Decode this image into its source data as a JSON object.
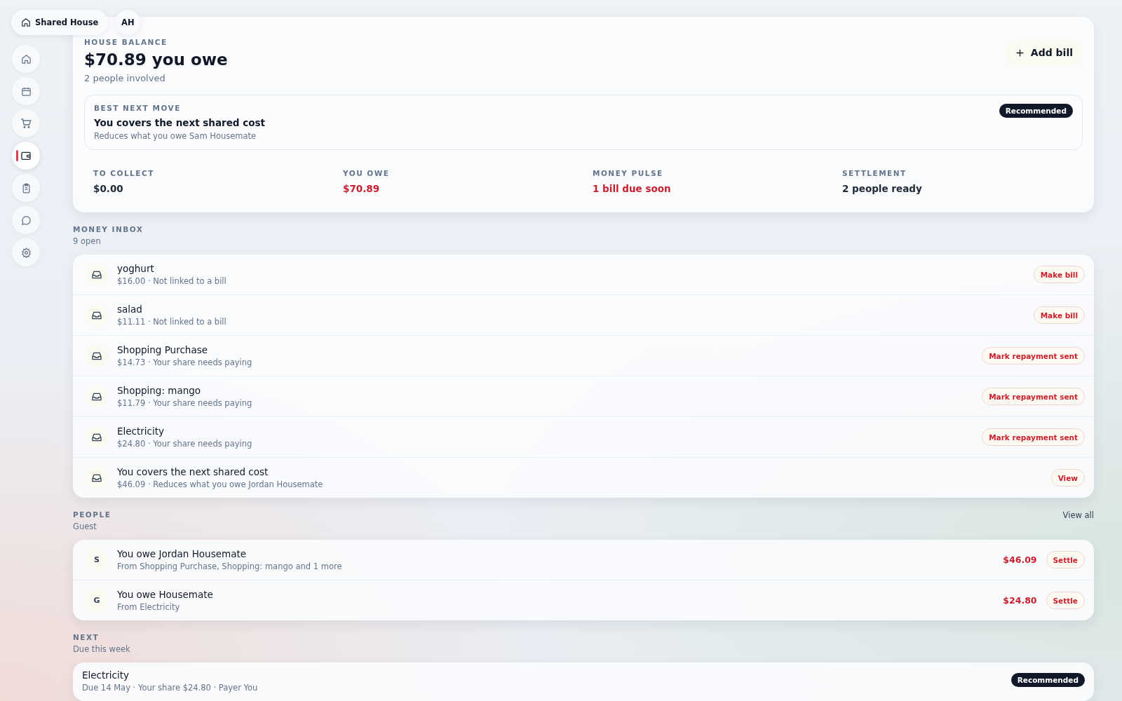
{
  "header": {
    "house": "Shared House",
    "avatar": "AH"
  },
  "sidebar": {
    "items": [
      {
        "selected": false
      },
      {
        "selected": false
      },
      {
        "selected": false
      },
      {
        "selected": true
      },
      {
        "selected": false
      },
      {
        "selected": false
      },
      {
        "selected": false
      }
    ]
  },
  "balance": {
    "eyebrow": "HOUSE BALANCE",
    "title": "$70.89 you owe",
    "subtitle": "2 people involved",
    "add_button": "Add bill",
    "best_move": {
      "eyebrow": "BEST NEXT MOVE",
      "title": "You covers the next shared cost",
      "detail": "Reduces what you owe Sam Housemate",
      "badge": "Recommended"
    },
    "stats": [
      {
        "label": "TO COLLECT",
        "value": "$0.00",
        "alert": false
      },
      {
        "label": "YOU OWE",
        "value": "$70.89",
        "alert": true
      },
      {
        "label": "MONEY PULSE",
        "value": "1 bill due soon",
        "alert": true
      },
      {
        "label": "SETTLEMENT",
        "value": "2 people ready",
        "alert": false
      }
    ]
  },
  "inbox": {
    "title": "MONEY INBOX",
    "subtitle": "9 open",
    "rows": [
      {
        "title": "yoghurt",
        "detail": "$16.00 · Not linked to a bill",
        "action": "Make bill"
      },
      {
        "title": "salad",
        "detail": "$11.11 · Not linked to a bill",
        "action": "Make bill"
      },
      {
        "title": "Shopping Purchase",
        "detail": "$14.73 · Your share needs paying",
        "action": "Mark repayment sent"
      },
      {
        "title": "Shopping: mango",
        "detail": "$11.79 · Your share needs paying",
        "action": "Mark repayment sent"
      },
      {
        "title": "Electricity",
        "detail": "$24.80 · Your share needs paying",
        "action": "Mark repayment sent"
      },
      {
        "title": "You covers the next shared cost",
        "detail": "$46.09 · Reduces what you owe Jordan Housemate",
        "action": "View"
      }
    ]
  },
  "people": {
    "title": "PEOPLE",
    "subtitle": "Guest",
    "view_all": "View all",
    "rows": [
      {
        "initial": "S",
        "title": "You owe Jordan Housemate",
        "detail": "From Shopping Purchase, Shopping: mango and 1 more",
        "amount": "$46.09",
        "action": "Settle"
      },
      {
        "initial": "G",
        "title": "You owe Housemate",
        "detail": "From Electricity",
        "amount": "$24.80",
        "action": "Settle"
      }
    ]
  },
  "next": {
    "title": "NEXT",
    "subtitle": "Due this week",
    "rows": [
      {
        "title": "Electricity",
        "detail": "Due 14 May · Your share $24.80 · Payer You",
        "badge": "Recommended"
      }
    ]
  }
}
